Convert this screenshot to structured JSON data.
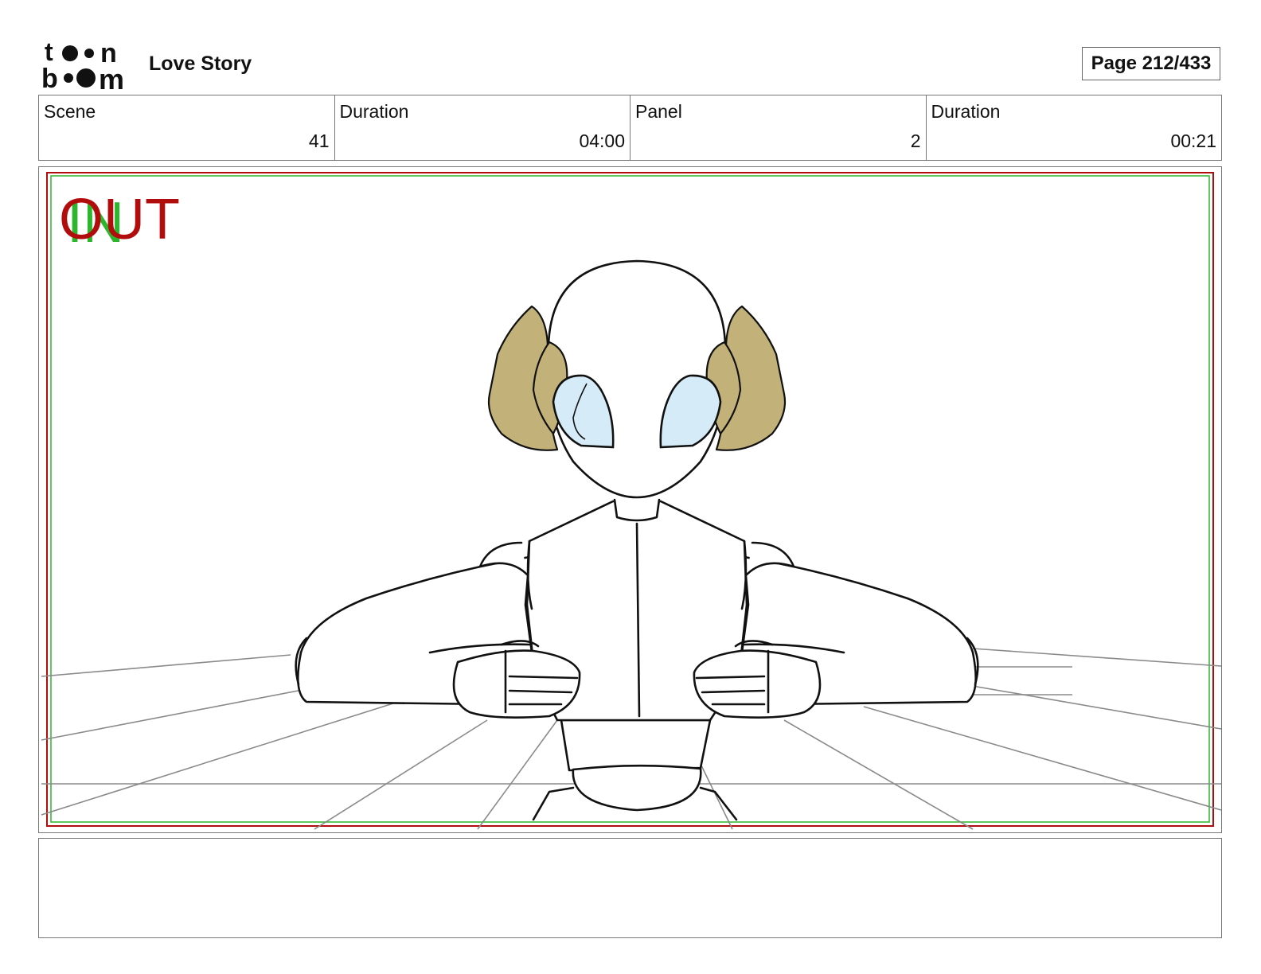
{
  "header": {
    "logo_text": "toon boom",
    "project_title": "Love Story",
    "page_indicator": "Page 212/433"
  },
  "info": {
    "scene_label": "Scene",
    "scene_value": "41",
    "scene_duration_label": "Duration",
    "scene_duration_value": "04:00",
    "panel_label": "Panel",
    "panel_value": "2",
    "panel_duration_label": "Duration",
    "panel_duration_value": "00:21"
  },
  "panel": {
    "in_marker": "IN",
    "out_marker": "OUT",
    "colors": {
      "in_frame": "#2db62d",
      "out_frame": "#b10d0d",
      "leaves": "#c2b27a",
      "eyes": "#d6ebf8"
    }
  },
  "caption": {
    "text": ""
  }
}
